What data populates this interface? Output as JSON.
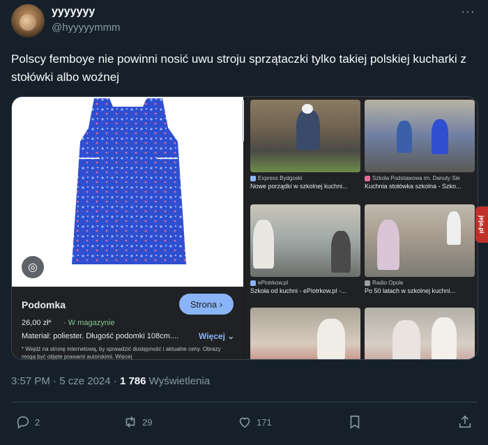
{
  "author": {
    "display_name": "yyyyyyy",
    "handle": "@hyyyyymmm"
  },
  "header": {
    "more_icon": "more-horizontal-icon"
  },
  "tweet": {
    "text": "Polscy femboye nie powinni nosić uwu stroju sprzątaczki tylko takiej polskiej kucharki z stołówki albo woźnej"
  },
  "product": {
    "title": "Podomka",
    "button_label": "Strona",
    "price": "26,00 zł*",
    "stock": "W magazynie",
    "description": "Materiał: poliester. Długość podomki 108cm....",
    "more_label": "Więcej",
    "disclaimer": "* Wejdź na stronę internetową, by sprawdzić dostępność i aktualne ceny. Obrazy mogą być objęte prawami autorskimi. Więcej"
  },
  "results": [
    {
      "source": "Express Bydgoski",
      "title": "Nowe porządki w szkolnej kuchni..."
    },
    {
      "source": "Szkoła Podstawowa im. Danuty Sie",
      "title": "Kuchnia stołówka szkolna - Szko..."
    },
    {
      "source": "ePiotrkow.pl",
      "title": "Szkoła od kuchni - ePiotrkow.pl -..."
    },
    {
      "source": "Radio Opole",
      "title": "Po 50 latach w szkolnej kuchni..."
    },
    {
      "source": "",
      "title": ""
    },
    {
      "source": "",
      "title": ""
    }
  ],
  "watermark": "jeja.pl",
  "meta": {
    "time": "3:57 PM",
    "date": "5 cze 2024",
    "views_count": "1 786",
    "views_label": "Wyświetlenia"
  },
  "actions": {
    "replies": "2",
    "retweets": "29",
    "likes": "171"
  },
  "colors": {
    "background": "#15202b",
    "accent": "#8ab4f8",
    "in_stock": "#81c995",
    "dress": "#2f4fd1"
  }
}
